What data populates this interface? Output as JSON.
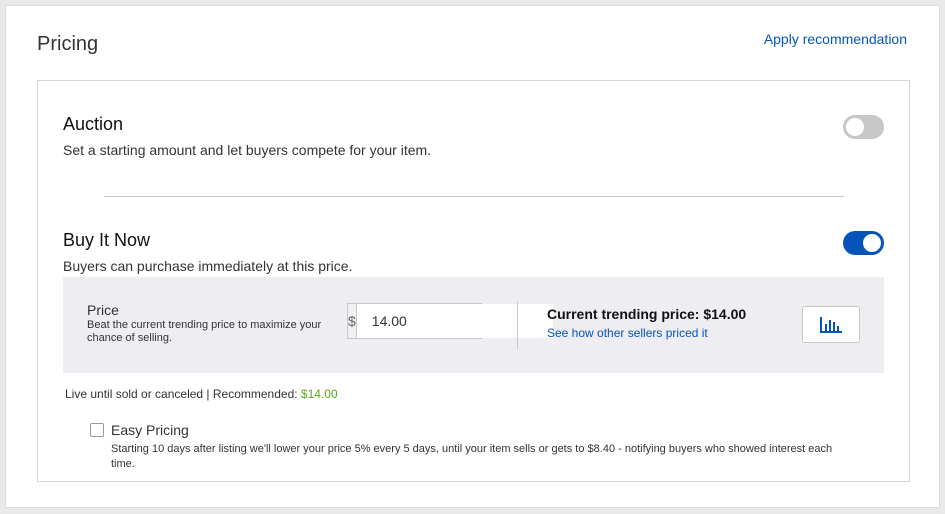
{
  "header": {
    "title": "Pricing",
    "apply_label": "Apply recommendation"
  },
  "auction": {
    "title": "Auction",
    "description": "Set a starting amount and let buyers compete for your item.",
    "enabled": false
  },
  "buy_it_now": {
    "title": "Buy It Now",
    "description": "Buyers can purchase immediately at this price.",
    "enabled": true
  },
  "price": {
    "label": "Price",
    "help": "Beat the current trending price to maximize your chance of selling.",
    "currency_symbol": "$",
    "value": "14.00",
    "trending_title": "Current trending price: $14.00",
    "trending_link": "See how other sellers priced it",
    "chart_button_icon": "bar-chart-icon"
  },
  "duration": {
    "text": "Live until sold or canceled | Recommended: ",
    "recommended_value": "$14.00"
  },
  "easy_pricing": {
    "label": "Easy Pricing",
    "checked": false,
    "description": "Starting 10 days after listing we'll lower your price 5% every 5 days, until your item sells or gets to $8.40 - notifying buyers who showed interest each time."
  },
  "colors": {
    "accent": "#0654ba",
    "recommended": "#5ba71b",
    "toggle_off": "#c7c7c7"
  }
}
